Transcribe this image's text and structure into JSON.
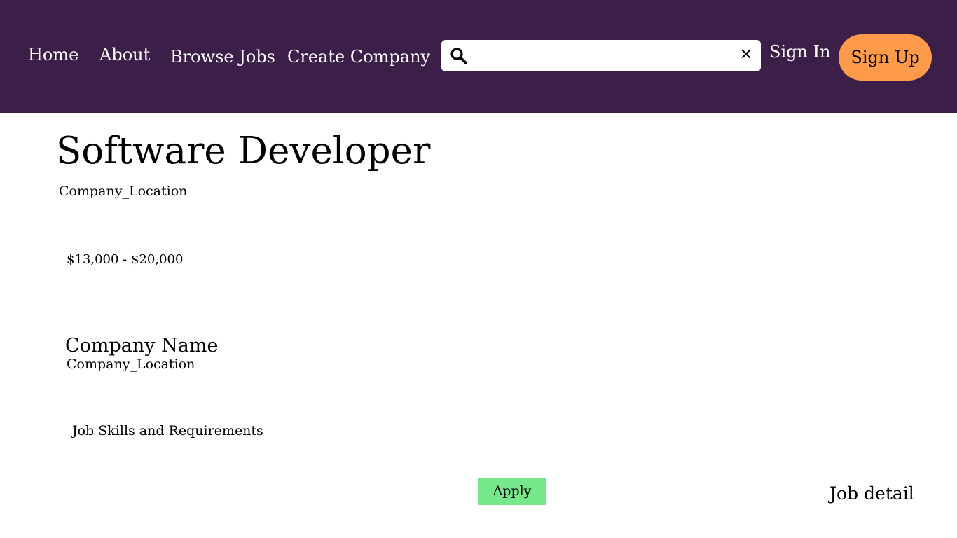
{
  "nav": {
    "home": "Home",
    "about": "About",
    "browse_jobs": "Browse Jobs",
    "create_company": "Create Company",
    "sign_in": "Sign In",
    "sign_up": "Sign Up"
  },
  "search": {
    "value": "",
    "placeholder": "",
    "search_icon": "search-icon",
    "clear_icon": "close-icon",
    "clear_glyph": "✕"
  },
  "job": {
    "title": "Software Developer",
    "location": "Company_Location",
    "salary": "$13,000 - $20,000",
    "company_name": "Company Name",
    "company_location": "Company_Location",
    "skills_heading": "Job Skills and Requirements",
    "apply_label": "Apply"
  },
  "footer_label": "Job detail",
  "colors": {
    "navbar_bg": "#3c1f49",
    "signup_bg": "#fd9b4b",
    "apply_bg": "#77e88a"
  }
}
